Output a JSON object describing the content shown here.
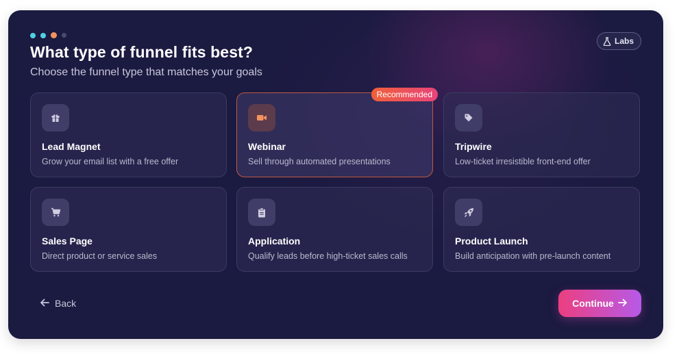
{
  "header": {
    "title": "What type of funnel fits best?",
    "subtitle": "Choose the funnel type that matches your goals",
    "labs_label": "Labs",
    "progress_steps": 4,
    "current_step": 3
  },
  "badge": {
    "label": "Recommended"
  },
  "cards": [
    {
      "title": "Lead Magnet",
      "description": "Grow your email list with a free offer",
      "icon": "gift-icon"
    },
    {
      "title": "Webinar",
      "description": "Sell through automated presentations",
      "icon": "video-camera-icon",
      "selected": true
    },
    {
      "title": "Tripwire",
      "description": "Low-ticket irresistible front-end offer",
      "icon": "tag-icon"
    },
    {
      "title": "Sales Page",
      "description": "Direct product or service sales",
      "icon": "cart-icon"
    },
    {
      "title": "Application",
      "description": "Qualify leads before high-ticket sales calls",
      "icon": "clipboard-icon"
    },
    {
      "title": "Product Launch",
      "description": "Build anticipation with pre-launch content",
      "icon": "rocket-icon"
    }
  ],
  "footer": {
    "back_label": "Back",
    "continue_label": "Continue"
  },
  "colors": {
    "panel_bg": "#1b1a40",
    "accent_orange": "#f4935d",
    "accent_cyan": "#4fd1e3",
    "continue_gradient_start": "#ec3f80",
    "continue_gradient_end": "#b65ae8"
  }
}
